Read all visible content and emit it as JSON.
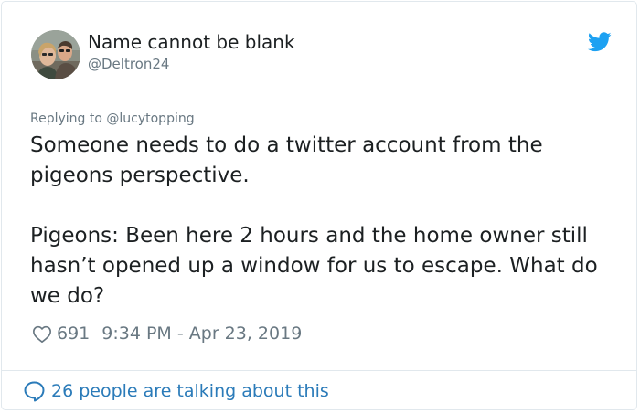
{
  "tweet": {
    "author": {
      "name": "Name cannot be blank",
      "handle": "@Deltron24",
      "avatar": "two-people-selfie-avatar"
    },
    "brand_icon": "bird-icon",
    "reply_context": "Replying to @lucytopping",
    "text": {
      "paragraph_1": "Someone needs to do a twitter account from the pigeons perspective.",
      "paragraph_2": "Pigeons: Been here 2 hours and the home owner still hasn’t opened up a window for us to escape. What do we do?"
    },
    "likes": "691",
    "timestamp": "9:34 PM - Apr 23, 2019",
    "conversation_link": "26 people are talking about this"
  },
  "colors": {
    "text_primary": "#1c2022",
    "text_secondary": "#697882",
    "link": "#2b7bb9",
    "brand": "#1da1f2",
    "border": "#e1e8ed"
  },
  "icons": {
    "brand": "bird-icon",
    "like": "heart-icon",
    "conversation": "speech-bubble-icon"
  }
}
